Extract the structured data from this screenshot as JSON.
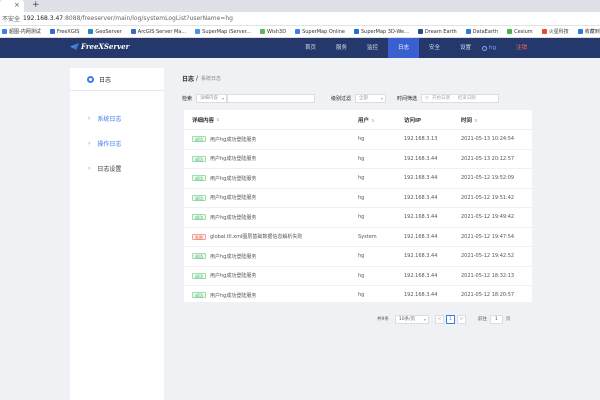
{
  "browser": {
    "insecure_label": "不安全",
    "url_host": "192.168.3.47",
    "url_path": ":8088/freeserver/main/log/systemLogList?userName=hg",
    "bookmarks": [
      {
        "label": "超图-内网测试",
        "color": "#3b7ded"
      },
      {
        "label": "FreeXGIS",
        "color": "#2f6ad9"
      },
      {
        "label": "GeoServer",
        "color": "#1e88c7"
      },
      {
        "label": "ArcGIS Server Ma...",
        "color": "#3b6bb5"
      },
      {
        "label": "SuperMap iServer...",
        "color": "#4a90e2"
      },
      {
        "label": "Wish3D",
        "color": "#5cb85c"
      },
      {
        "label": "SuperMap Online",
        "color": "#3b7ded"
      },
      {
        "label": "SuperMap 3D-We...",
        "color": "#1f6fd6"
      },
      {
        "label": "Dream Earth",
        "color": "#2a4b8d"
      },
      {
        "label": "DataEarth",
        "color": "#2b7cd3"
      },
      {
        "label": "Cesium",
        "color": "#48b04a"
      },
      {
        "label": "火星科技",
        "color": "#e6492d"
      },
      {
        "label": "收藏到我网站",
        "color": "#2a7ae2"
      }
    ]
  },
  "nav": {
    "items": [
      "首页",
      "服务",
      "监控",
      "日志",
      "安全",
      "设置"
    ],
    "active": "日志",
    "user": "hg",
    "logout": "注销"
  },
  "sidebar": {
    "title": "日志",
    "items": [
      {
        "label": "系统日志"
      },
      {
        "label": "操作日志"
      },
      {
        "label": "日志设置"
      }
    ]
  },
  "breadcrumb": {
    "section": "日志",
    "separator": "/",
    "page": "系统日志"
  },
  "filters": {
    "search_label": "检索",
    "search_type": "详细内容",
    "level_label": "级别过滤",
    "level_value": "全部",
    "time_label": "时间筛选",
    "start_placeholder": "开始日期",
    "end_placeholder": "结束日期"
  },
  "table": {
    "columns": [
      "详细内容",
      "用户",
      "访问IP",
      "时间"
    ],
    "rows": [
      {
        "tag": "成功",
        "tag_type": "ok",
        "desc": "用户hg成功登陆服务",
        "user": "hg",
        "ip": "192.168.3.13",
        "time": "2021-05-13 10:24:54"
      },
      {
        "tag": "成功",
        "tag_type": "ok",
        "desc": "用户hg成功登陆服务",
        "user": "hg",
        "ip": "192.168.3.44",
        "time": "2021-05-13 20:12:57"
      },
      {
        "tag": "成功",
        "tag_type": "ok",
        "desc": "用户hg成功登陆服务",
        "user": "hg",
        "ip": "192.168.3.44",
        "time": "2021-05-12 19:52:09"
      },
      {
        "tag": "成功",
        "tag_type": "ok",
        "desc": "用户hg成功登陆服务",
        "user": "hg",
        "ip": "192.168.3.44",
        "time": "2021-05-12 19:51:42"
      },
      {
        "tag": "成功",
        "tag_type": "ok",
        "desc": "用户hg成功登陆服务",
        "user": "hg",
        "ip": "192.168.3.44",
        "time": "2021-05-12 19:49:42"
      },
      {
        "tag": "失败",
        "tag_type": "fail",
        "desc": "global.tll.xml图层基础数据信息解析失败",
        "user": "System",
        "ip": "192.168.3.44",
        "time": "2021-05-12 19:47:54"
      },
      {
        "tag": "成功",
        "tag_type": "ok",
        "desc": "用户hg成功登陆服务",
        "user": "hg",
        "ip": "192.168.3.44",
        "time": "2021-05-12 19:42:52"
      },
      {
        "tag": "成功",
        "tag_type": "ok",
        "desc": "用户hg成功登陆服务",
        "user": "hg",
        "ip": "192.168.3.44",
        "time": "2021-05-12 18:32:13"
      },
      {
        "tag": "成功",
        "tag_type": "ok",
        "desc": "用户hg成功登陆服务",
        "user": "hg",
        "ip": "192.168.3.44",
        "time": "2021-05-12 18:20:57"
      }
    ]
  },
  "pagination": {
    "total": "共9条",
    "page_size": "10条/页",
    "prev": "<",
    "current": "1",
    "next": ">",
    "goto_label": "前往",
    "goto_value": "1",
    "page_unit": "页"
  }
}
